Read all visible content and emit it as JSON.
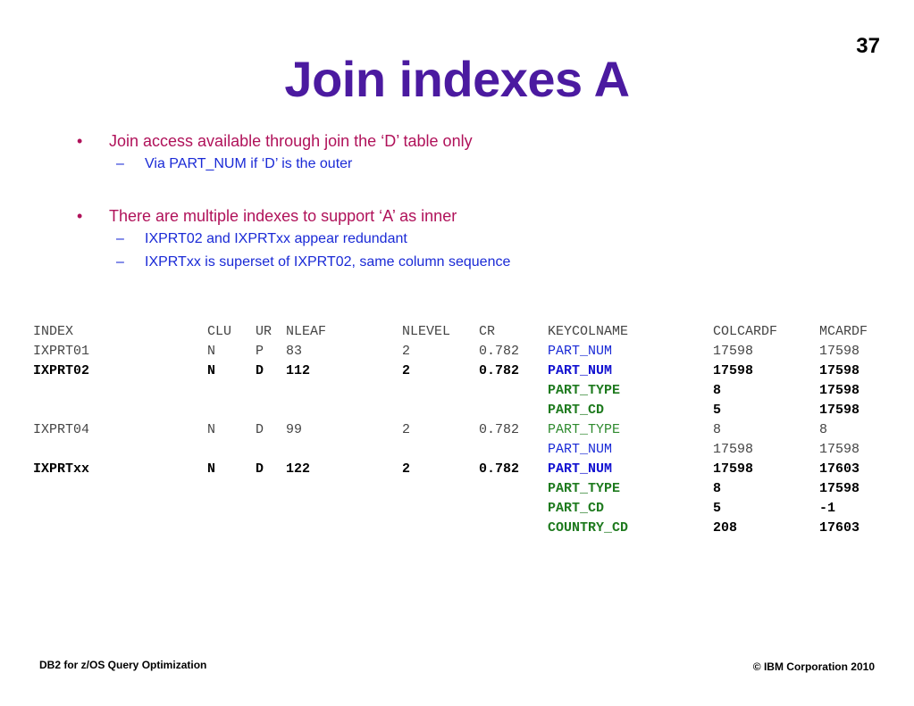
{
  "slide_number": "37",
  "title": "Join indexes A",
  "bullets": [
    {
      "text": "Join access available through join the ‘D’ table only",
      "sub": [
        "Via PART_NUM if ‘D’ is the outer"
      ]
    },
    {
      "text": "There are multiple indexes to support ‘A’ as inner",
      "sub": [
        "IXPRT02 and IXPRTxx appear redundant",
        "IXPRTxx is superset of IXPRT02, same column sequence"
      ]
    }
  ],
  "table": {
    "headers": [
      "INDEX",
      "CLU",
      "UR",
      "NLEAF",
      "NLEVEL",
      "CR",
      "KEYCOLNAME",
      "COLCARDF",
      "MCARDF"
    ],
    "rows": [
      [
        "IXPRT01",
        "N",
        "P",
        "83",
        "2",
        "0.782",
        "PART_NUM",
        "17598",
        "17598"
      ],
      [
        "IXPRT02",
        "N",
        "D",
        "112",
        "2",
        "0.782",
        "PART_NUM",
        "17598",
        "17598"
      ],
      [
        "",
        "",
        "",
        "",
        "",
        "",
        "PART_TYPE",
        "8",
        "17598"
      ],
      [
        "",
        "",
        "",
        "",
        "",
        "",
        "PART_CD",
        "5",
        "17598"
      ],
      [
        "IXPRT04",
        "N",
        "D",
        "99",
        "2",
        "0.782",
        "PART_TYPE",
        "8",
        "8"
      ],
      [
        "",
        "",
        "",
        "",
        "",
        "",
        "PART_NUM",
        "17598",
        "17598"
      ],
      [
        "IXPRTxx",
        "N",
        "D",
        "122",
        "2",
        "0.782",
        "PART_NUM",
        "17598",
        "17603"
      ],
      [
        "",
        "",
        "",
        "",
        "",
        "",
        "PART_TYPE",
        "8",
        "17598"
      ],
      [
        "",
        "",
        "",
        "",
        "",
        "",
        "PART_CD",
        "5",
        "-1"
      ],
      [
        "",
        "",
        "",
        "",
        "",
        "",
        "COUNTRY_CD",
        "208",
        "17603"
      ]
    ],
    "bold_rows": [
      1,
      2,
      3,
      6,
      7,
      8,
      9
    ],
    "keycol_colors": [
      "blue",
      "blue",
      "green",
      "green",
      "green",
      "blue",
      "blue",
      "green",
      "green",
      "green"
    ]
  },
  "footer": {
    "left": "DB2 for z/OS Query Optimization",
    "right": "© IBM Corporation 2010"
  },
  "colors": {
    "title": "#4b1aa0",
    "bullet_l1": "#b0125a",
    "bullet_l2": "#1a2ad6",
    "keycol_blue": "#1a2ad6",
    "keycol_green": "#2e8a2e"
  }
}
